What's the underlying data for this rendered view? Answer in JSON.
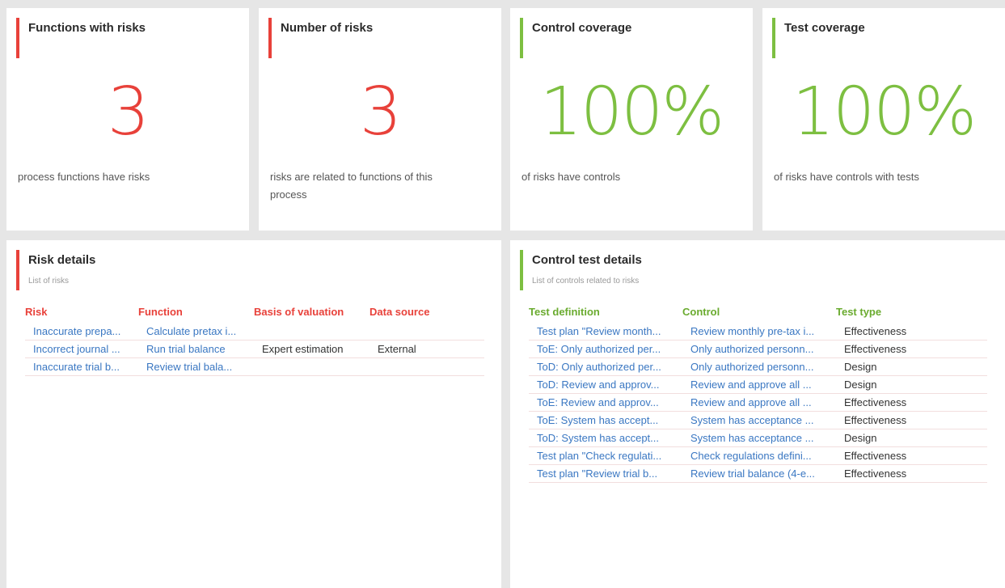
{
  "kpis": [
    {
      "title": "Functions with risks",
      "value": "3",
      "description": "process functions have risks"
    },
    {
      "title": "Number of risks",
      "value": "3",
      "description": "risks are related to functions of this process"
    },
    {
      "title": "Control coverage",
      "value": "100%",
      "description": "of risks have controls"
    },
    {
      "title": "Test coverage",
      "value": "100%",
      "description": "of risks have controls with tests"
    }
  ],
  "risk_details": {
    "title": "Risk details",
    "subtitle": "List of risks",
    "columns": [
      "Risk",
      "Function",
      "Basis of valuation",
      "Data source"
    ],
    "rows": [
      [
        "Inaccurate prepa...",
        "Calculate pretax i...",
        "",
        ""
      ],
      [
        "Incorrect journal ...",
        "Run trial balance",
        "Expert estimation",
        "External"
      ],
      [
        "Inaccurate trial b...",
        "Review trial bala...",
        "",
        ""
      ]
    ]
  },
  "control_test_details": {
    "title": "Control test details",
    "subtitle": "List of controls related to risks",
    "columns": [
      "Test definition",
      "Control",
      "Test type"
    ],
    "rows": [
      [
        "Test plan \"Review month...",
        "Review monthly pre-tax i...",
        "Effectiveness"
      ],
      [
        "ToE: Only authorized per...",
        "Only authorized personn...",
        "Effectiveness"
      ],
      [
        "ToD: Only authorized per...",
        "Only authorized personn...",
        "Design"
      ],
      [
        "ToD: Review and approv...",
        "Review and approve all ...",
        "Design"
      ],
      [
        "ToE: Review and approv...",
        "Review and approve all ...",
        "Effectiveness"
      ],
      [
        "ToE: System has accept...",
        "System has acceptance ...",
        "Effectiveness"
      ],
      [
        "ToD: System has accept...",
        "System has acceptance ...",
        "Design"
      ],
      [
        "Test plan \"Check regulati...",
        "Check regulations defini...",
        "Effectiveness"
      ],
      [
        "Test plan \"Review trial b...",
        "Review trial balance (4-e...",
        "Effectiveness"
      ]
    ]
  },
  "colors": {
    "risk_accent": "#e8413a",
    "ok_accent": "#7dbf41",
    "link": "#3a77c2"
  }
}
